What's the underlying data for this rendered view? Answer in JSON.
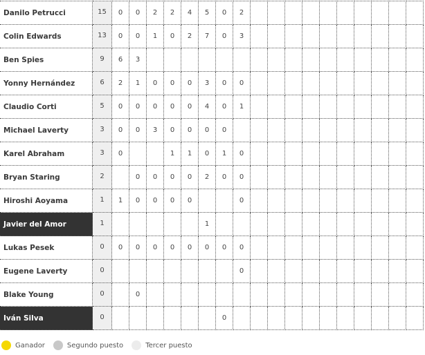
{
  "standings": [
    {
      "rider": "Danilo Petrucci",
      "total": "15",
      "races": [
        "0",
        "0",
        "2",
        "2",
        "4",
        "5",
        "0",
        "2",
        null,
        null,
        null,
        null,
        null,
        null,
        null,
        null,
        null,
        null
      ]
    },
    {
      "rider": "Colin Edwards",
      "total": "13",
      "races": [
        "0",
        "0",
        "1",
        "0",
        "2",
        "7",
        "0",
        "3",
        null,
        null,
        null,
        null,
        null,
        null,
        null,
        null,
        null,
        null
      ]
    },
    {
      "rider": "Ben Spies",
      "total": "9",
      "races": [
        "6",
        "3",
        null,
        null,
        null,
        null,
        null,
        null,
        null,
        null,
        null,
        null,
        null,
        null,
        null,
        null,
        null,
        null
      ]
    },
    {
      "rider": "Yonny Hernández",
      "total": "6",
      "races": [
        "2",
        "1",
        "0",
        "0",
        "0",
        "3",
        "0",
        "0",
        null,
        null,
        null,
        null,
        null,
        null,
        null,
        null,
        null,
        null
      ]
    },
    {
      "rider": "Claudio Corti",
      "total": "5",
      "races": [
        "0",
        "0",
        "0",
        "0",
        "0",
        "4",
        "0",
        "1",
        null,
        null,
        null,
        null,
        null,
        null,
        null,
        null,
        null,
        null
      ]
    },
    {
      "rider": "Michael Laverty",
      "total": "3",
      "races": [
        "0",
        "0",
        "3",
        "0",
        "0",
        "0",
        "0",
        null,
        null,
        null,
        null,
        null,
        null,
        null,
        null,
        null,
        null,
        null
      ]
    },
    {
      "rider": "Karel Abraham",
      "total": "3",
      "races": [
        "0",
        null,
        null,
        "1",
        "1",
        "0",
        "1",
        "0",
        null,
        null,
        null,
        null,
        null,
        null,
        null,
        null,
        null,
        null
      ]
    },
    {
      "rider": "Bryan Staring",
      "total": "2",
      "races": [
        null,
        "0",
        "0",
        "0",
        "0",
        "2",
        "0",
        "0",
        null,
        null,
        null,
        null,
        null,
        null,
        null,
        null,
        null,
        null
      ]
    },
    {
      "rider": "Hiroshi Aoyama",
      "total": "1",
      "races": [
        "1",
        "0",
        "0",
        "0",
        "0",
        null,
        null,
        "0",
        null,
        null,
        null,
        null,
        null,
        null,
        null,
        null,
        null,
        null
      ]
    },
    {
      "rider": "Javier del Amor",
      "total": "1",
      "highlight": true,
      "races": [
        null,
        null,
        null,
        null,
        null,
        "1",
        null,
        null,
        null,
        null,
        null,
        null,
        null,
        null,
        null,
        null,
        null,
        null
      ]
    },
    {
      "rider": "Lukas Pesek",
      "total": "0",
      "races": [
        "0",
        "0",
        "0",
        "0",
        "0",
        "0",
        "0",
        "0",
        null,
        null,
        null,
        null,
        null,
        null,
        null,
        null,
        null,
        null
      ]
    },
    {
      "rider": "Eugene Laverty",
      "total": "0",
      "races": [
        null,
        null,
        null,
        null,
        null,
        null,
        null,
        "0",
        null,
        null,
        null,
        null,
        null,
        null,
        null,
        null,
        null,
        null
      ]
    },
    {
      "rider": "Blake Young",
      "total": "0",
      "races": [
        null,
        "0",
        null,
        null,
        null,
        null,
        null,
        null,
        null,
        null,
        null,
        null,
        null,
        null,
        null,
        null,
        null,
        null
      ]
    },
    {
      "rider": "Iván Silva",
      "total": "0",
      "highlight": true,
      "races": [
        null,
        null,
        null,
        null,
        null,
        null,
        "0",
        null,
        null,
        null,
        null,
        null,
        null,
        null,
        null,
        null,
        null,
        null
      ]
    }
  ],
  "legend": [
    {
      "label": "Ganador",
      "color": "#f5d800"
    },
    {
      "label": "Segundo puesto",
      "color": "#c8c8c8"
    },
    {
      "label": "Tercer puesto",
      "color": "#ececec"
    }
  ],
  "colors": {
    "highlight_bg": "#333333",
    "total_bg": "#efefef"
  }
}
